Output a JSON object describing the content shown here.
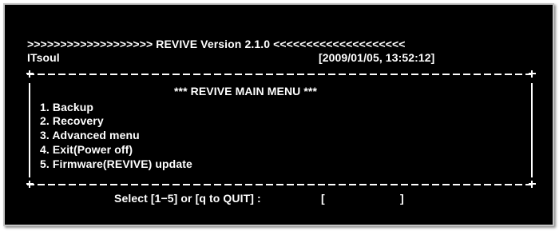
{
  "header": {
    "banner": ">>>>>>>>>>>>>>>>>>> REVIVE Version 2.1.0 <<<<<<<<<<<<<<<<<<<<",
    "user": "ITsoul",
    "timestamp": "[2009/01/05, 13:52:12]"
  },
  "menu": {
    "title": "*** REVIVE MAIN MENU ***",
    "items": [
      {
        "label": "1. Backup"
      },
      {
        "label": "2. Recovery"
      },
      {
        "label": "3. Advanced menu"
      },
      {
        "label": "4. Exit(Power off)"
      },
      {
        "label": "5. Firmware(REVIVE) update"
      }
    ]
  },
  "prompt": {
    "text": "Select [1−5] or [q to QUIT] :",
    "open_bracket": "[",
    "close_bracket": "]",
    "value": ""
  },
  "colors": {
    "background": "#000000",
    "foreground": "#ffffff",
    "frame": "#c4c4c4"
  }
}
